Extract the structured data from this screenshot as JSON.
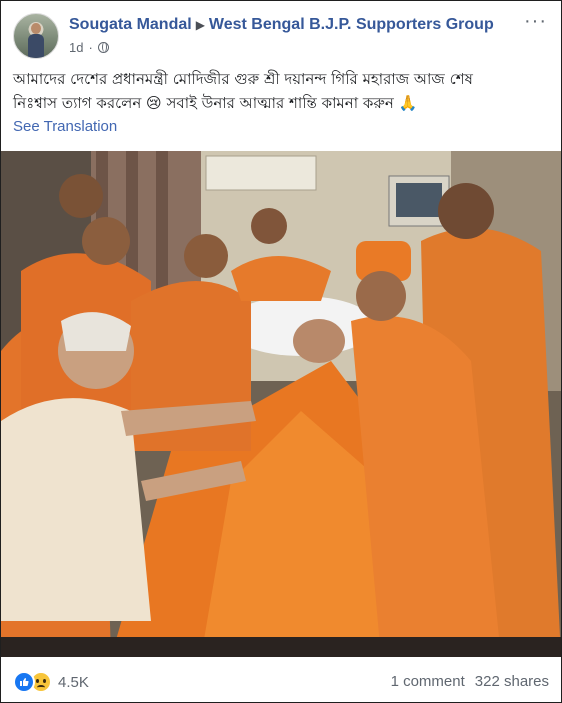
{
  "post": {
    "author": "Sougata Mandal",
    "group": "West Bengal B.J.P. Supporters Group",
    "time": "1d",
    "privacy_icon": "globe-icon",
    "text_line1": "আমাদের দেশের প্রধানমন্ত্রী মোদিজীর গুরু শ্রী দয়ানন্দ গিরি মহারাজ আজ শেষ",
    "text_line2": "নিঃশ্বাস ত্যাগ করলেন 😢  সবাই উনার আত্মার শান্তি কামনা করুন 🙏",
    "see_translation": "See Translation"
  },
  "footer": {
    "reaction_icons": [
      "like-icon",
      "sad-icon"
    ],
    "reaction_count": "4.5K",
    "comments": "1 comment",
    "shares": "322 shares"
  },
  "colors": {
    "link": "#365899",
    "secondary_link": "#4267b2",
    "saffron": "#e87722",
    "text_secondary": "#606770"
  }
}
